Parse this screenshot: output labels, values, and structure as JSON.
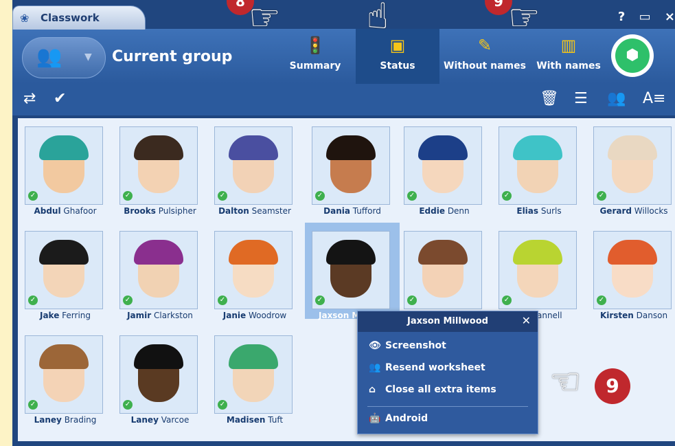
{
  "window": {
    "tab_title": "Classwork",
    "controls": [
      "?",
      "▭",
      "×"
    ]
  },
  "header": {
    "group_title": "Current group",
    "views": [
      {
        "label": "Summary",
        "icon": "traffic-light-icon"
      },
      {
        "label": "Status",
        "icon": "status-card-icon"
      },
      {
        "label": "Without names",
        "icon": "eraser-icon"
      },
      {
        "label": "With names",
        "icon": "bar-chart-icon"
      }
    ]
  },
  "students": [
    {
      "first": "Abdul",
      "last": "Ghafoor",
      "hair": "#2aa39a",
      "skin": "#f2c9a0"
    },
    {
      "first": "Brooks",
      "last": "Pulsipher",
      "hair": "#3b2a1f",
      "skin": "#f3d2b3"
    },
    {
      "first": "Dalton",
      "last": "Seamster",
      "hair": "#4a4fa0",
      "skin": "#f2d2b6"
    },
    {
      "first": "Dania",
      "last": "Tufford",
      "hair": "#1f140e",
      "skin": "#c67c4e"
    },
    {
      "first": "Eddie",
      "last": "Denn",
      "hair": "#1c3f88",
      "skin": "#f5d7bd"
    },
    {
      "first": "Elias",
      "last": "Surls",
      "hair": "#3fc3c7",
      "skin": "#f2d3b5"
    },
    {
      "first": "Gerard",
      "last": "Willocks",
      "hair": "#e9d8c2",
      "skin": "#f4d8be"
    },
    {
      "first": "Jake",
      "last": "Ferring",
      "hair": "#1b1b1b",
      "skin": "#f3d5b8"
    },
    {
      "first": "Jamir",
      "last": "Clarkston",
      "hair": "#8a2f8e",
      "skin": "#f1d2b3"
    },
    {
      "first": "Janie",
      "last": "Woodrow",
      "hair": "#e06a24",
      "skin": "#f6dcc3"
    },
    {
      "first": "Jaxson",
      "last": "Millwood",
      "hair": "#141414",
      "skin": "#5b3a24"
    },
    {
      "first": "",
      "last": "",
      "hair": "#7b4a2e",
      "skin": "#f3d2b6"
    },
    {
      "first": "",
      "last": "Channell",
      "hair": "#b9d431",
      "skin": "#f4d6ba"
    },
    {
      "first": "Kirsten",
      "last": "Danson",
      "hair": "#e15d2d",
      "skin": "#f8dcc6"
    },
    {
      "first": "Laney",
      "last": "Brading",
      "hair": "#9c6638",
      "skin": "#f4d3b6"
    },
    {
      "first": "Laney",
      "last": "Varcoe",
      "hair": "#111111",
      "skin": "#5a3a22"
    },
    {
      "first": "Madisen",
      "last": "Tuft",
      "hair": "#3aa86d",
      "skin": "#f2d5b8"
    }
  ],
  "labels": {
    "jaxson_truncated": "Jaxson M",
    "channell_visible": "Channell"
  },
  "popup": {
    "title": "Jaxson Millwood",
    "items": [
      {
        "label": "Screenshot",
        "icon": "eye-icon"
      },
      {
        "label": "Resend worksheet",
        "icon": "users-resend-icon"
      },
      {
        "label": "Close all extra items",
        "icon": "close-items-icon"
      },
      {
        "label": "Android",
        "icon": "android-icon"
      }
    ]
  },
  "callouts": {
    "left": "8",
    "right": "9",
    "main": "9"
  }
}
